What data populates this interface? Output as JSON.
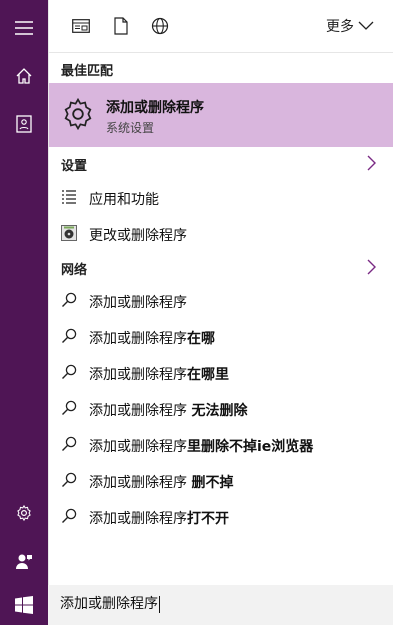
{
  "search": {
    "query": "添加或删除程序"
  },
  "toolbar": {
    "more_label": "更多"
  },
  "best_match": {
    "header": "最佳匹配",
    "title": "添加或删除程序",
    "subtitle": "系统设置"
  },
  "settings": {
    "header": "设置",
    "items": [
      {
        "label": "应用和功能",
        "icon": "list-icon"
      },
      {
        "label": "更改或删除程序",
        "icon": "disk-icon"
      }
    ]
  },
  "web": {
    "header": "网络",
    "suggestions": [
      {
        "prefix": "添加或删除程序",
        "suffix": ""
      },
      {
        "prefix": "添加或删除程序",
        "suffix": "在哪"
      },
      {
        "prefix": "添加或删除程序",
        "suffix": "在哪里"
      },
      {
        "prefix": "添加或删除程序 ",
        "suffix": "无法删除"
      },
      {
        "prefix": "添加或删除程序",
        "suffix": "里删除不掉ie浏览器"
      },
      {
        "prefix": "添加或删除程序 ",
        "suffix": "删不掉"
      },
      {
        "prefix": "添加或删除程序",
        "suffix": "打不开"
      }
    ]
  },
  "colors": {
    "accent": "#4f1555",
    "highlight": "#d9b6dd"
  }
}
